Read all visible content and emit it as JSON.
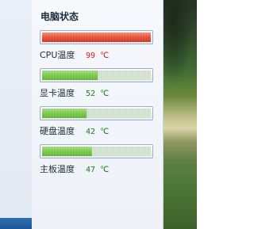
{
  "panel": {
    "title": "电脑状态",
    "rows": [
      {
        "name": "CPU温度",
        "value": "99 ℃",
        "level_percent": 100,
        "bar_color": "red",
        "value_color": "#cc1f1f"
      },
      {
        "name": "显卡温度",
        "value": "52 ℃",
        "level_percent": 51,
        "bar_color": "green",
        "value_color": "#1a7d1a"
      },
      {
        "name": "硬盘温度",
        "value": "42 ℃",
        "level_percent": 41,
        "bar_color": "green",
        "value_color": "#1a7d1a"
      },
      {
        "name": "主板温度",
        "value": "47 ℃",
        "level_percent": 46,
        "bar_color": "green",
        "value_color": "#1a7d1a"
      }
    ]
  }
}
